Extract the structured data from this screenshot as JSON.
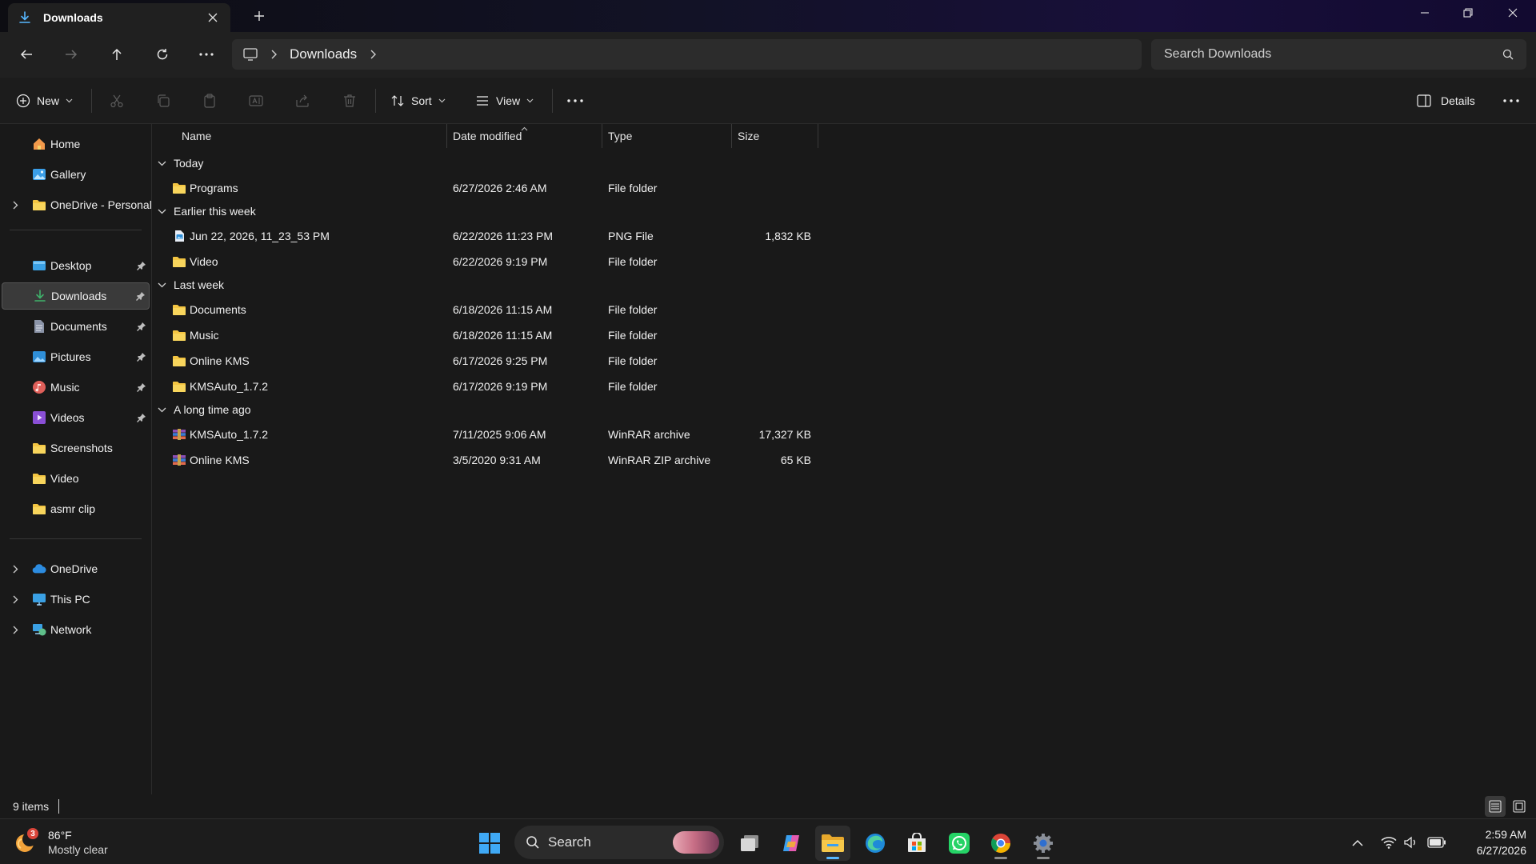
{
  "window": {
    "tab_title": "Downloads",
    "tab_icon": "download-icon",
    "controls": [
      "minimize-icon",
      "restore-icon",
      "close-icon"
    ]
  },
  "address": {
    "breadcrumb": [
      "Downloads"
    ],
    "search_placeholder": "Search Downloads"
  },
  "commandbar": {
    "new_label": "New",
    "sort_label": "Sort",
    "view_label": "View",
    "details_label": "Details",
    "disabled_actions": [
      "cut-icon",
      "copy-icon",
      "paste-icon",
      "rename-icon",
      "share-icon",
      "delete-icon"
    ]
  },
  "sidebar": {
    "top_items": [
      {
        "label": "Home",
        "icon": "home-icon"
      },
      {
        "label": "Gallery",
        "icon": "gallery-icon"
      },
      {
        "label": "OneDrive - Personal",
        "icon": "folder-icon",
        "expandable": true
      }
    ],
    "quick_access": [
      {
        "label": "Desktop",
        "icon": "desktop-icon",
        "pinned": true
      },
      {
        "label": "Downloads",
        "icon": "download-icon",
        "pinned": true,
        "selected": true
      },
      {
        "label": "Documents",
        "icon": "documents-icon",
        "pinned": true
      },
      {
        "label": "Pictures",
        "icon": "pictures-icon",
        "pinned": true
      },
      {
        "label": "Music",
        "icon": "music-icon",
        "pinned": true
      },
      {
        "label": "Videos",
        "icon": "videos-icon",
        "pinned": true
      },
      {
        "label": "Screenshots",
        "icon": "folder-icon"
      },
      {
        "label": "Video",
        "icon": "folder-icon"
      },
      {
        "label": "asmr clip",
        "icon": "folder-icon"
      }
    ],
    "bottom_items": [
      {
        "label": "OneDrive",
        "icon": "cloud-icon",
        "expandable": true
      },
      {
        "label": "This PC",
        "icon": "pc-icon",
        "expandable": true
      },
      {
        "label": "Network",
        "icon": "network-icon",
        "expandable": true
      }
    ]
  },
  "filelist": {
    "columns": {
      "name": "Name",
      "date": "Date modified",
      "type": "Type",
      "size": "Size"
    },
    "groups": [
      {
        "title": "Today",
        "rows": [
          {
            "name": "Programs",
            "date": "6/27/2026 2:46 AM",
            "type": "File folder",
            "size": "",
            "icon": "folder-icon"
          }
        ]
      },
      {
        "title": "Earlier this week",
        "rows": [
          {
            "name": "Jun 22, 2026, 11_23_53 PM",
            "date": "6/22/2026 11:23 PM",
            "type": "PNG File",
            "size": "1,832 KB",
            "icon": "image-file-icon"
          },
          {
            "name": "Video",
            "date": "6/22/2026 9:19 PM",
            "type": "File folder",
            "size": "",
            "icon": "folder-icon"
          }
        ]
      },
      {
        "title": "Last week",
        "rows": [
          {
            "name": "Documents",
            "date": "6/18/2026 11:15 AM",
            "type": "File folder",
            "size": "",
            "icon": "folder-icon"
          },
          {
            "name": "Music",
            "date": "6/18/2026 11:15 AM",
            "type": "File folder",
            "size": "",
            "icon": "folder-icon"
          },
          {
            "name": "Online KMS",
            "date": "6/17/2026 9:25 PM",
            "type": "File folder",
            "size": "",
            "icon": "folder-icon"
          },
          {
            "name": "KMSAuto_1.7.2",
            "date": "6/17/2026 9:19 PM",
            "type": "File folder",
            "size": "",
            "icon": "folder-icon"
          }
        ]
      },
      {
        "title": "A long time ago",
        "rows": [
          {
            "name": "KMSAuto_1.7.2",
            "date": "7/11/2025 9:06 AM",
            "type": "WinRAR archive",
            "size": "17,327 KB",
            "icon": "winrar-icon"
          },
          {
            "name": "Online KMS",
            "date": "3/5/2020 9:31 AM",
            "type": "WinRAR ZIP archive",
            "size": "65 KB",
            "icon": "winrar-icon"
          }
        ]
      }
    ]
  },
  "status": {
    "item_count": "9 items"
  },
  "taskbar": {
    "weather_temp": "86°F",
    "weather_desc": "Mostly clear",
    "weather_badge": "3",
    "search_label": "Search",
    "clock_time": "2:59 AM",
    "clock_date": "6/27/2026",
    "pinned_apps": [
      "start-icon",
      "task-view-icon",
      "copilot-icon",
      "file-explorer-icon",
      "edge-icon",
      "store-icon",
      "whatsapp-icon",
      "chrome-icon",
      "settings-icon"
    ]
  },
  "colors": {
    "accent": "#57b7ff",
    "folder": "#f4c542",
    "background": "#191919"
  }
}
